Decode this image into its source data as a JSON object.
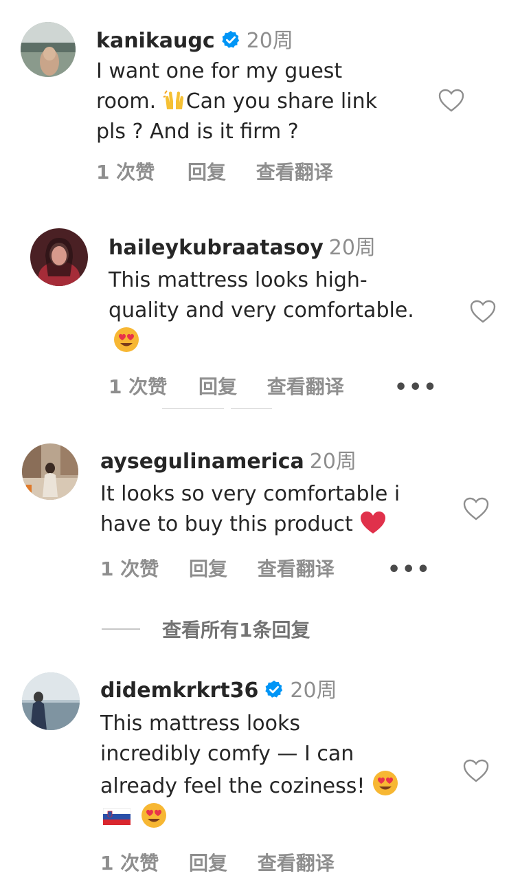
{
  "comments": [
    {
      "username": "kanikaugc",
      "verified": true,
      "time": "20周",
      "lines": [
        "I want one for my guest",
        "room. ",
        "pls ? And is it firm ?"
      ],
      "line2_rest": "Can you share link",
      "emoji1": "raising-hands-emoji",
      "likes": "1 次赞",
      "reply": "回复",
      "translate": "查看翻译"
    },
    {
      "username": "haileykubraatasoy",
      "verified": false,
      "time": "20周",
      "lines": [
        "This mattress looks high-",
        "quality and very comfortable."
      ],
      "emoji1": "heart-eyes-emoji",
      "likes": "1 次赞",
      "reply": "回复",
      "translate": "查看翻译",
      "more": "•••"
    },
    {
      "username": "aysegulinamerica",
      "verified": false,
      "time": "20周",
      "lines": [
        "It looks so very comfortable i",
        "have to buy this product "
      ],
      "emoji1": "red-heart-emoji",
      "likes": "1 次赞",
      "reply": "回复",
      "translate": "查看翻译",
      "more": "•••",
      "view_replies": "查看所有1条回复"
    },
    {
      "username": "didemkrkrt36",
      "verified": true,
      "time": "20周",
      "lines": [
        "This mattress looks",
        "incredibly comfy — I can",
        "already feel the coziness! "
      ],
      "emoji1": "heart-eyes-emoji",
      "emoji2": "slovenia-flag-emoji",
      "likes": "1 次赞",
      "reply": "回复",
      "translate": "查看翻译"
    }
  ],
  "colors": {
    "text": "#262626",
    "secondary": "#8e8e8e",
    "verified_blue": "#0095f6"
  }
}
